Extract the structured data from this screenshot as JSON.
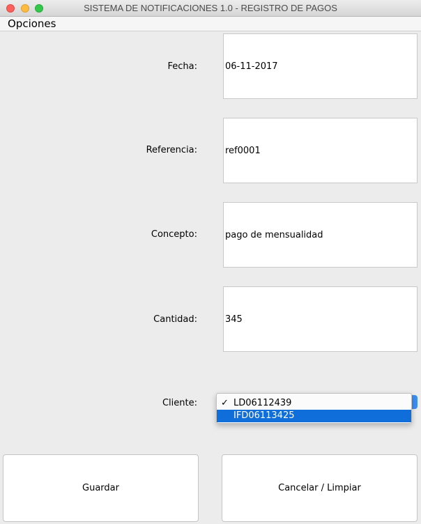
{
  "window": {
    "title": "SISTEMA DE NOTIFICACIONES 1.0 - REGISTRO DE PAGOS"
  },
  "menu": {
    "opciones": "Opciones"
  },
  "form": {
    "fecha": {
      "label": "Fecha:",
      "value": "06-11-2017"
    },
    "referencia": {
      "label": "Referencia:",
      "value": "ref0001"
    },
    "concepto": {
      "label": "Concepto:",
      "value": "pago de mensualidad"
    },
    "cantidad": {
      "label": "Cantidad:",
      "value": "345"
    },
    "cliente": {
      "label": "Cliente:",
      "options": [
        "LD06112439",
        "IFD06113425"
      ],
      "selected": "LD06112439",
      "highlighted": "IFD06113425",
      "check_mark": "✓"
    }
  },
  "buttons": {
    "guardar": "Guardar",
    "cancelar": "Cancelar / Limpiar"
  },
  "colors": {
    "highlight": "#0f6ed9",
    "close": "#fc605c",
    "minimize": "#fdbc40",
    "maximize": "#34c84a"
  }
}
